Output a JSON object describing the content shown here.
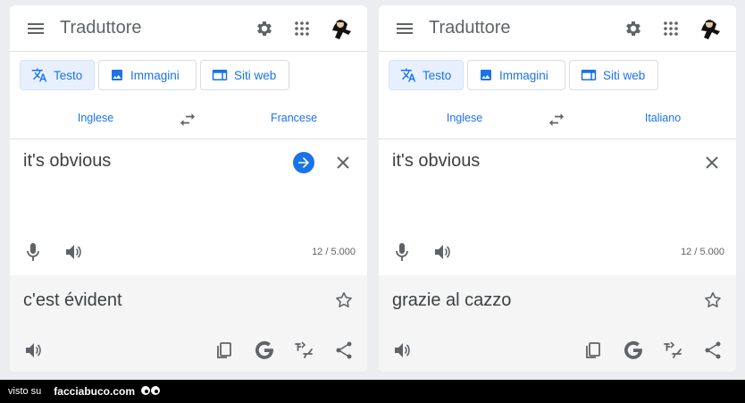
{
  "colors": {
    "accent": "#1a73e8",
    "text": "#3c4043",
    "muted": "#5f6368",
    "output_bg": "#f5f5f5"
  },
  "panels": [
    {
      "app_title": "Traduttore",
      "tabs": [
        {
          "label": "Testo",
          "icon": "translate-icon",
          "active": true
        },
        {
          "label": "Immagini",
          "icon": "image-icon",
          "active": false
        },
        {
          "label": "Siti web",
          "icon": "website-icon",
          "active": false
        }
      ],
      "source_lang": "Inglese",
      "target_lang": "Francese",
      "source_text": "it's obvious",
      "char_count": "12 / 5.000",
      "translation": "c'est évident",
      "show_go_button": true
    },
    {
      "app_title": "Traduttore",
      "tabs": [
        {
          "label": "Testo",
          "icon": "translate-icon",
          "active": true
        },
        {
          "label": "Immagini",
          "icon": "image-icon",
          "active": false
        },
        {
          "label": "Siti web",
          "icon": "website-icon",
          "active": false
        }
      ],
      "source_lang": "Inglese",
      "target_lang": "Italiano",
      "source_text": "it's obvious",
      "char_count": "12 / 5.000",
      "translation": "grazie al cazzo",
      "show_go_button": false
    }
  ],
  "footer": {
    "visto": "visto su",
    "site": "facciabuco.com"
  }
}
